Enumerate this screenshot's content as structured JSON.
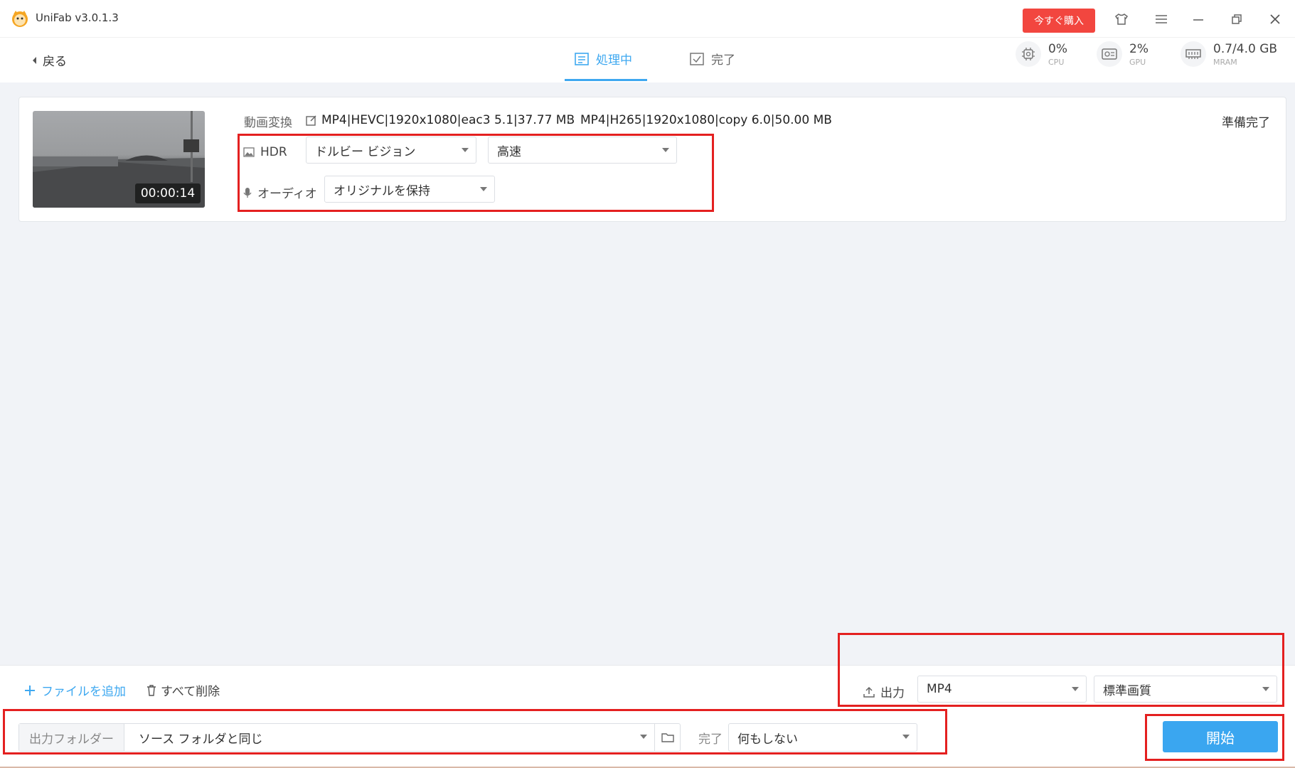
{
  "app": {
    "title": "UniFab v3.0.1.3",
    "buy_label": "今すぐ購入"
  },
  "nav": {
    "back_label": "戻る",
    "tabs": [
      {
        "label": "処理中",
        "active": true
      },
      {
        "label": "完了",
        "active": false
      }
    ]
  },
  "stats": {
    "cpu": {
      "value": "0%",
      "label": "CPU"
    },
    "gpu": {
      "value": "2%",
      "label": "GPU"
    },
    "mram": {
      "value": "0.7/4.0 GB",
      "label": "MRAM"
    }
  },
  "task": {
    "duration": "00:00:14",
    "conversion_label": "動画変換",
    "source_info": "MP4|HEVC|1920x1080|eac3 5.1|37.77 MB",
    "output_info": "MP4|H265|1920x1080|copy 6.0|50.00 MB",
    "status": "準備完了",
    "hdr_label": "HDR",
    "hdr_mode": "ドルビー ビジョン",
    "hdr_speed": "高速",
    "audio_label": "オーディオ",
    "audio_mode": "オリジナルを保持"
  },
  "bottom": {
    "add_file_label": "ファイルを追加",
    "delete_all_label": "すべて削除",
    "output_label": "出力",
    "output_format": "MP4",
    "output_quality": "標準画質",
    "folder_label": "出力フォルダー",
    "folder_value": "ソース フォルダと同じ",
    "done_label": "完了",
    "done_action": "何もしない",
    "start_label": "開始"
  },
  "colors": {
    "accent": "#3ea8f0",
    "buy": "#f2463f",
    "highlight": "#e42020"
  }
}
